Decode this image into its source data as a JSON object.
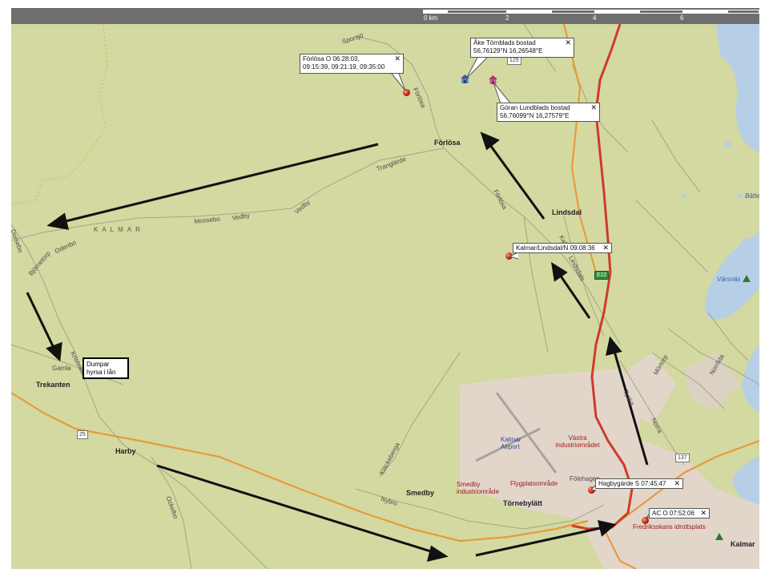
{
  "scale_bar": {
    "unit_label": "0 km",
    "ticks": [
      "2",
      "4",
      "6"
    ]
  },
  "places": {
    "forlosa": "Förlösa",
    "lindsdal": "Lindsdal",
    "trekanten": "Trekanten",
    "harby": "Harby",
    "smedby": "Smedby",
    "tornebylatt": "Törnebylätt",
    "folehagen": "Fölehagen",
    "kalmar_city": "Kalmar",
    "district": "KALMAR"
  },
  "road_names": {
    "sporsjo": "Sporsjö",
    "forlosa_road_n": "Förlösa",
    "tranglarde": "Tranglärde",
    "mossebo": "Mossebo",
    "vedby1": "Vedby",
    "vedby2": "Vedby",
    "forlosa_road_s": "Förlösa",
    "kalmar_road": "Kalmar",
    "lindsdals": "Lindsdals",
    "dorsebo": "Dorsebo",
    "bjornetorp": "Björnetorp",
    "odenbo": "Odenbo",
    "kristvalla": "Kristvalla",
    "gamla": "Gamla",
    "kleftebacke": "Kläckeberga",
    "ockeshom": "Ockelbo",
    "nybro": "Nybro",
    "tyska": "Tyska",
    "norra": "Norra",
    "mortorp": "Mörtorp",
    "norrlida": "Norrlida"
  },
  "areas": {
    "airport": "Kalmar Airport",
    "vastra": "Västra industriområdet",
    "smedby_ind": "Smedby industriområde",
    "flygplats": "Flygplatsområde",
    "fredriksskans": "Fredriksskans idrottsplats"
  },
  "water": {
    "varsnas": "Värsnäs",
    "battle": "Bätte"
  },
  "shields": {
    "r125": "125",
    "e22": "E22",
    "r25": "25",
    "r137": "137"
  },
  "callouts": {
    "forlosa_o": {
      "line1": "Förlösa O 06:28:03,",
      "line2": "09:15:39, 09:21:19, 09:35:00"
    },
    "ake": {
      "line1": "Åke Törnblads bostad",
      "line2": "56,76129°N 16,26548°E"
    },
    "goran": {
      "line1": "Göran Lundblads bostad",
      "line2": "56,76099°N 16,27579°E"
    },
    "kalmar_lindsdal": {
      "line1": "Kalmar/Lindsdal/N 09:08:36"
    },
    "hagbygarde": {
      "line1": "Hagbygärde S 07:45:47"
    },
    "ac_o": {
      "line1": "AC O 07:52:06"
    }
  },
  "close_glyph": "✕",
  "note": {
    "line1": "Dumpar",
    "line2": "hyrsa i lån"
  },
  "colors": {
    "land": "#d3d9a0",
    "urban": "#e2d6cb",
    "water": "#b6cfe6",
    "motorway": "#d03a2a",
    "orange_road": "#e89a3c",
    "minor_road": "#a3a48a",
    "arrow": "#111111"
  },
  "icons": [
    "house-icon-blue",
    "house-icon-red",
    "location-pin-icon",
    "close-icon"
  ]
}
